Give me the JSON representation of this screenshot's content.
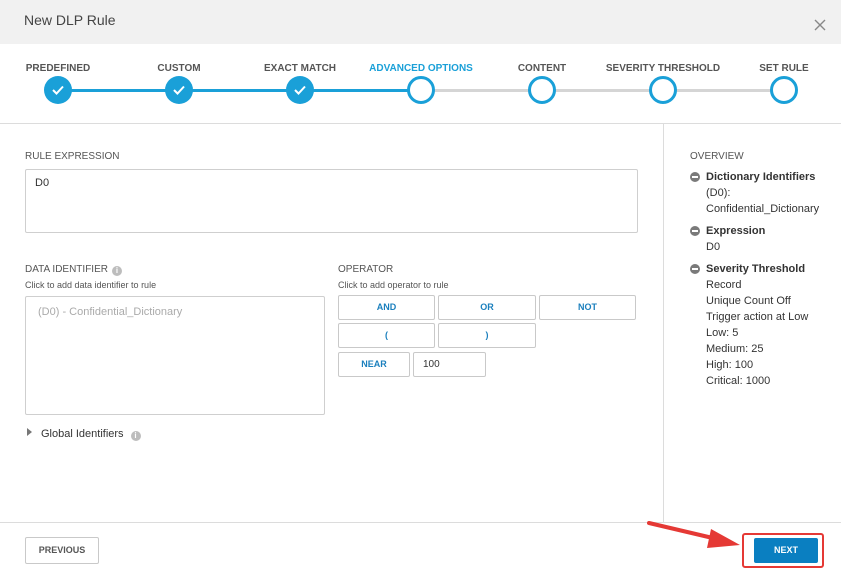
{
  "dialog": {
    "title": "New DLP Rule"
  },
  "steps": [
    {
      "label": "PREDEFINED",
      "state": "done"
    },
    {
      "label": "CUSTOM",
      "state": "done"
    },
    {
      "label": "EXACT MATCH",
      "state": "done"
    },
    {
      "label": "ADVANCED OPTIONS",
      "state": "current"
    },
    {
      "label": "CONTENT",
      "state": "todo"
    },
    {
      "label": "SEVERITY THRESHOLD",
      "state": "todo"
    },
    {
      "label": "SET RULE",
      "state": "todo"
    }
  ],
  "rule_expression": {
    "label": "RULE EXPRESSION",
    "value": "D0"
  },
  "data_identifier": {
    "label": "DATA IDENTIFIER",
    "hint": "Click to add data identifier to rule",
    "items": [
      "(D0) - Confidential_Dictionary"
    ]
  },
  "operator": {
    "label": "OPERATOR",
    "hint": "Click to add operator to rule",
    "buttons": {
      "and": "AND",
      "or": "OR",
      "not": "NOT",
      "lparen": "(",
      "rparen": ")",
      "near": "NEAR"
    },
    "near_value": "100"
  },
  "global_identifiers": {
    "label": "Global Identifiers"
  },
  "overview": {
    "title": "OVERVIEW",
    "dictionary": {
      "heading": "Dictionary Identifiers",
      "lines": [
        "(D0):",
        "Confidential_Dictionary"
      ]
    },
    "expression": {
      "heading": "Expression",
      "lines": [
        "D0"
      ]
    },
    "severity": {
      "heading": "Severity Threshold",
      "lines": [
        "Record",
        "Unique Count Off",
        "Trigger action at Low",
        "Low: 5",
        "Medium: 25",
        "High: 100",
        "Critical: 1000"
      ]
    }
  },
  "footer": {
    "previous": "PREVIOUS",
    "next": "NEXT"
  },
  "colors": {
    "accent": "#1aa0d8",
    "primary_button": "#0a7fc1",
    "highlight": "#e53935"
  },
  "icons": {
    "close": "close-icon",
    "check": "check-icon",
    "info": "info-icon",
    "collapse": "minus-circle-icon",
    "expand": "triangle-right-icon"
  }
}
